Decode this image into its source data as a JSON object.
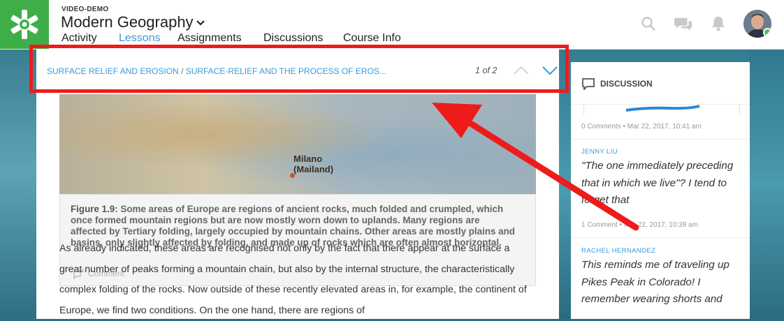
{
  "header": {
    "course_label": "VIDEO-DEMO",
    "course_title": "Modern Geography",
    "nav": [
      {
        "label": "Activity",
        "active": false
      },
      {
        "label": "Lessons",
        "active": true
      },
      {
        "label": "Assignments",
        "active": false
      },
      {
        "label": "Discussions",
        "active": false
      },
      {
        "label": "Course Info",
        "active": false
      }
    ],
    "icons": [
      "search-icon",
      "messages-icon",
      "notifications-icon"
    ]
  },
  "breadcrumb": {
    "section": "SURFACE RELIEF AND EROSION",
    "separator": "/",
    "page": "SURFACE-RELIEF AND THE PROCESS OF EROS...",
    "pager": "1 of 2"
  },
  "figure": {
    "map_label_1": "Milano",
    "map_label_2": "(Mailand)",
    "caption_label": "Figure 1.9",
    "caption_text": ": Some areas of Europe are regions of ancient rocks, much folded and crumpled, which once formed mountain regions but are now mostly worn down to uplands. Many regions are affected by Tertiary folding, largely occupied by mountain chains. Other areas are mostly plains and basins, only slightly affected by folding, and made up of rocks which are often almost horizontal.",
    "comment_label": "Comment"
  },
  "body_text": "As already indicated, these areas are recognised not only by the fact that there appear at the surface a great number of peaks forming a mountain chain, but also by the internal structure, the characteristically complex folding of the rocks. Now outside of these recently elevated areas in, for example, the continent of Europe, we find two conditions. On the one hand, there are regions of",
  "sidebar": {
    "title": "DISCUSSION",
    "items": [
      {
        "meta": "0 Comments  •  Mar 22, 2017, 10:41 am"
      },
      {
        "author": "JENNY LIU",
        "quote": "\"The one immediately preceding that in which we live\"? I tend to forget that",
        "meta": "1 Comment  •  Mar 22, 2017, 10:39 am"
      },
      {
        "author": "RACHEL HERNANDEZ",
        "quote": "This reminds me of traveling up Pikes Peak in Colorado! I remember wearing shorts and"
      }
    ]
  },
  "colors": {
    "brand_green": "#3fae49",
    "link_blue": "#3a9ad9",
    "highlight_red": "#ee1b1b"
  }
}
